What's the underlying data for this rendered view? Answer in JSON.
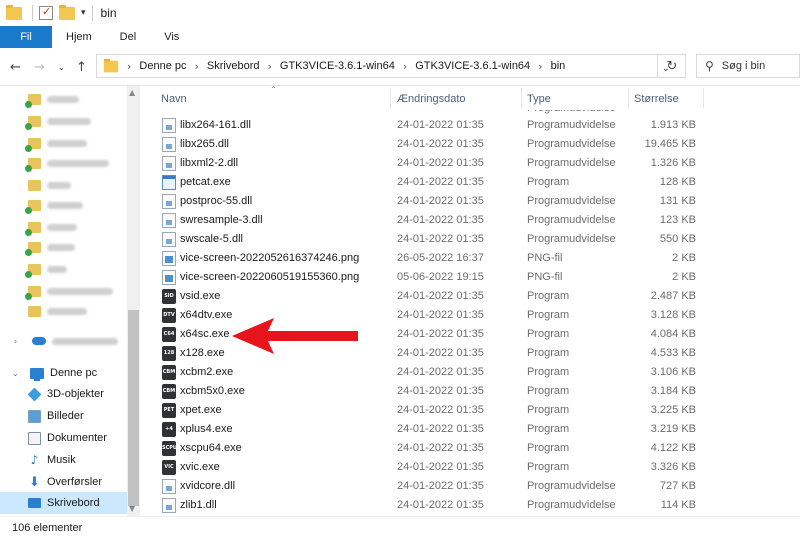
{
  "titlebar": {
    "title": "bin"
  },
  "ribbon": {
    "tabs": [
      "Fil",
      "Hjem",
      "Del",
      "Vis"
    ]
  },
  "address": {
    "crumbs": [
      "Denne pc",
      "Skrivebord",
      "GTK3VICE-3.6.1-win64",
      "GTK3VICE-3.6.1-win64",
      "bin"
    ],
    "search_placeholder": "Søg i bin"
  },
  "sidebar": {
    "this_pc": "Denne pc",
    "items": [
      "3D-objekter",
      "Billeder",
      "Dokumenter",
      "Musik",
      "Overførsler",
      "Skrivebord"
    ]
  },
  "columns": {
    "name": "Navn",
    "date": "Ændringsdato",
    "type": "Type",
    "size": "Størrelse"
  },
  "files": [
    {
      "name": "libx264-161.dll",
      "date": "24-01-2022 01:35",
      "type": "Programudvidelse",
      "size": "1.913 KB",
      "icon": "dll-icon"
    },
    {
      "name": "libx265.dll",
      "date": "24-01-2022 01:35",
      "type": "Programudvidelse",
      "size": "19.465 KB",
      "icon": "dll-icon"
    },
    {
      "name": "libxml2-2.dll",
      "date": "24-01-2022 01:35",
      "type": "Programudvidelse",
      "size": "1.326 KB",
      "icon": "dll-icon"
    },
    {
      "name": "petcat.exe",
      "date": "24-01-2022 01:35",
      "type": "Program",
      "size": "128 KB",
      "icon": "exe-icon"
    },
    {
      "name": "postproc-55.dll",
      "date": "24-01-2022 01:35",
      "type": "Programudvidelse",
      "size": "131 KB",
      "icon": "dll-icon"
    },
    {
      "name": "swresample-3.dll",
      "date": "24-01-2022 01:35",
      "type": "Programudvidelse",
      "size": "123 KB",
      "icon": "dll-icon"
    },
    {
      "name": "swscale-5.dll",
      "date": "24-01-2022 01:35",
      "type": "Programudvidelse",
      "size": "550 KB",
      "icon": "dll-icon"
    },
    {
      "name": "vice-screen-2022052616374246.png",
      "date": "26-05-2022 16:37",
      "type": "PNG-fil",
      "size": "2 KB",
      "icon": "png-icon"
    },
    {
      "name": "vice-screen-2022060519155360.png",
      "date": "05-06-2022 19:15",
      "type": "PNG-fil",
      "size": "2 KB",
      "icon": "png-icon"
    },
    {
      "name": "vsid.exe",
      "date": "24-01-2022 01:35",
      "type": "Program",
      "size": "2.487 KB",
      "icon": "c64-icon",
      "glyph": "SID"
    },
    {
      "name": "x64dtv.exe",
      "date": "24-01-2022 01:35",
      "type": "Program",
      "size": "3.128 KB",
      "icon": "c64-icon",
      "glyph": "DTV"
    },
    {
      "name": "x64sc.exe",
      "date": "24-01-2022 01:35",
      "type": "Program",
      "size": "4.084 KB",
      "icon": "c64-icon",
      "glyph": "C64"
    },
    {
      "name": "x128.exe",
      "date": "24-01-2022 01:35",
      "type": "Program",
      "size": "4.533 KB",
      "icon": "c64-icon",
      "glyph": "128"
    },
    {
      "name": "xcbm2.exe",
      "date": "24-01-2022 01:35",
      "type": "Program",
      "size": "3.106 KB",
      "icon": "c64-icon",
      "glyph": "CBM"
    },
    {
      "name": "xcbm5x0.exe",
      "date": "24-01-2022 01:35",
      "type": "Program",
      "size": "3.184 KB",
      "icon": "c64-icon",
      "glyph": "CBM"
    },
    {
      "name": "xpet.exe",
      "date": "24-01-2022 01:35",
      "type": "Program",
      "size": "3.225 KB",
      "icon": "c64-icon",
      "glyph": "PET"
    },
    {
      "name": "xplus4.exe",
      "date": "24-01-2022 01:35",
      "type": "Program",
      "size": "3.219 KB",
      "icon": "c64-icon",
      "glyph": "+4"
    },
    {
      "name": "xscpu64.exe",
      "date": "24-01-2022 01:35",
      "type": "Program",
      "size": "4.122 KB",
      "icon": "c64-icon",
      "glyph": "SCPU"
    },
    {
      "name": "xvic.exe",
      "date": "24-01-2022 01:35",
      "type": "Program",
      "size": "3.326 KB",
      "icon": "c64-icon",
      "glyph": "VIC"
    },
    {
      "name": "xvidcore.dll",
      "date": "24-01-2022 01:35",
      "type": "Programudvidelse",
      "size": "727 KB",
      "icon": "dll-icon"
    },
    {
      "name": "zlib1.dll",
      "date": "24-01-2022 01:35",
      "type": "Programudvidelse",
      "size": "114 KB",
      "icon": "dll-icon"
    }
  ],
  "status": {
    "count": "106 elementer"
  },
  "colors": {
    "accent": "#1979ca",
    "annotation_arrow": "#e8141c",
    "selected_bg": "#cce8ff"
  }
}
